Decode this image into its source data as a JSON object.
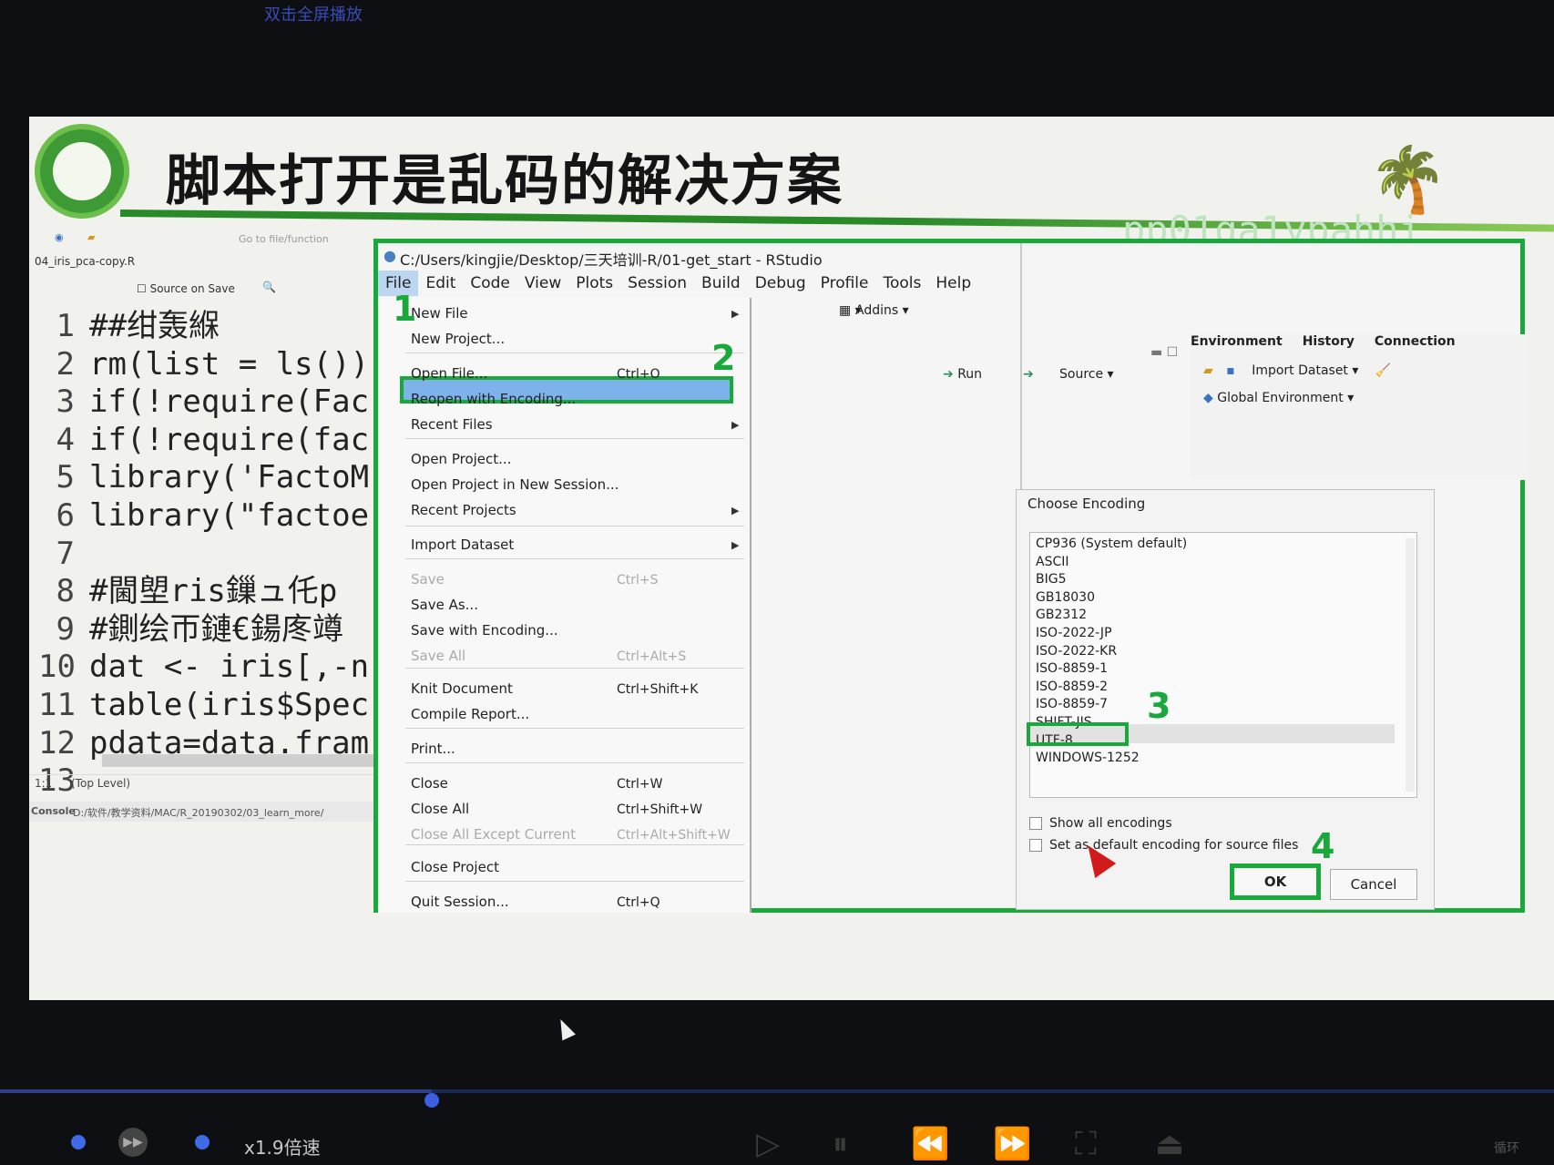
{
  "top_notice": "双击全屏播放",
  "slide": {
    "title": "脚本打开是乱码的解决方案",
    "watermark": "pp01qa1ypahhi"
  },
  "editor": {
    "toolbar_goto": "Go to file/function",
    "tab": "04_iris_pca-copy.R",
    "source_on_save": "Source on Save",
    "lines": [
      {
        "n": "1",
        "text": "##绀轰緥"
      },
      {
        "n": "2",
        "text": "rm(list = ls())"
      },
      {
        "n": "3",
        "text": "if(!require(Fac"
      },
      {
        "n": "4",
        "text": "if(!require(fac"
      },
      {
        "n": "5",
        "text": "library('FactoM"
      },
      {
        "n": "6",
        "text": "library(\"factoe"
      },
      {
        "n": "7",
        "text": ""
      },
      {
        "n": "8",
        "text": "#閫塱ris鏁ュ仛p"
      },
      {
        "n": "9",
        "text": "#鍘绘帀鏈€鍚庝竴"
      },
      {
        "n": "10",
        "text": "dat <- iris[,-n"
      },
      {
        "n": "11",
        "text": "table(iris$Spec"
      },
      {
        "n": "12",
        "text": "pdata=data.fram"
      },
      {
        "n": "13",
        "text": ""
      }
    ],
    "status_pos": "1:1",
    "status_level": "(Top Level)",
    "console_label": "Console",
    "console_path": "D:/软件/教学资料/MAC/R_20190302/03_learn_more/"
  },
  "rstudio": {
    "title": "C:/Users/kingjie/Desktop/三天培训-R/01-get_start - RStudio",
    "menu": [
      "File",
      "Edit",
      "Code",
      "View",
      "Plots",
      "Session",
      "Build",
      "Debug",
      "Profile",
      "Tools",
      "Help"
    ],
    "addins": "Addins",
    "run": "Run",
    "source": "Source",
    "env_tabs": [
      "Environment",
      "History",
      "Connection"
    ],
    "import_dataset": "Import Dataset",
    "global_env": "Global Environment"
  },
  "file_menu": {
    "items": [
      {
        "label": "New File",
        "shortcut": "",
        "submenu": true,
        "disabled": false
      },
      {
        "label": "New Project...",
        "shortcut": "",
        "submenu": false,
        "disabled": false
      },
      {
        "label": "Open File...",
        "shortcut": "Ctrl+O",
        "submenu": false,
        "disabled": false
      },
      {
        "label": "Reopen with Encoding...",
        "shortcut": "",
        "submenu": false,
        "disabled": false
      },
      {
        "label": "Recent Files",
        "shortcut": "",
        "submenu": true,
        "disabled": false
      },
      {
        "label": "Open Project...",
        "shortcut": "",
        "submenu": false,
        "disabled": false
      },
      {
        "label": "Open Project in New Session...",
        "shortcut": "",
        "submenu": false,
        "disabled": false
      },
      {
        "label": "Recent Projects",
        "shortcut": "",
        "submenu": true,
        "disabled": false
      },
      {
        "label": "Import Dataset",
        "shortcut": "",
        "submenu": true,
        "disabled": false
      },
      {
        "label": "Save",
        "shortcut": "Ctrl+S",
        "submenu": false,
        "disabled": true
      },
      {
        "label": "Save As...",
        "shortcut": "",
        "submenu": false,
        "disabled": false
      },
      {
        "label": "Save with Encoding...",
        "shortcut": "",
        "submenu": false,
        "disabled": false
      },
      {
        "label": "Save All",
        "shortcut": "Ctrl+Alt+S",
        "submenu": false,
        "disabled": true
      },
      {
        "label": "Knit Document",
        "shortcut": "Ctrl+Shift+K",
        "submenu": false,
        "disabled": false
      },
      {
        "label": "Compile Report...",
        "shortcut": "",
        "submenu": false,
        "disabled": false
      },
      {
        "label": "Print...",
        "shortcut": "",
        "submenu": false,
        "disabled": false
      },
      {
        "label": "Close",
        "shortcut": "Ctrl+W",
        "submenu": false,
        "disabled": false
      },
      {
        "label": "Close All",
        "shortcut": "Ctrl+Shift+W",
        "submenu": false,
        "disabled": false
      },
      {
        "label": "Close All Except Current",
        "shortcut": "Ctrl+Alt+Shift+W",
        "submenu": false,
        "disabled": true
      },
      {
        "label": "Close Project",
        "shortcut": "",
        "submenu": false,
        "disabled": false
      },
      {
        "label": "Quit Session...",
        "shortcut": "Ctrl+Q",
        "submenu": false,
        "disabled": false
      }
    ]
  },
  "steps": [
    "1",
    "2",
    "3",
    "4"
  ],
  "encoding_dialog": {
    "title": "Choose Encoding",
    "encodings": [
      "CP936 (System default)",
      "ASCII",
      "BIG5",
      "GB18030",
      "GB2312",
      "ISO-2022-JP",
      "ISO-2022-KR",
      "ISO-8859-1",
      "ISO-8859-2",
      "ISO-8859-7",
      "SHIFT-JIS",
      "UTF-8",
      "WINDOWS-1252"
    ],
    "selected": "UTF-8",
    "show_all": "Show all encodings",
    "set_default": "Set as default encoding for source files",
    "ok": "OK",
    "cancel": "Cancel"
  },
  "player": {
    "speed": "x1.9倍速",
    "loop": "循环",
    "progress": 0.278
  },
  "colors": {
    "highlight_green": "#19a83a",
    "menu_selected": "#7eb2ea"
  }
}
